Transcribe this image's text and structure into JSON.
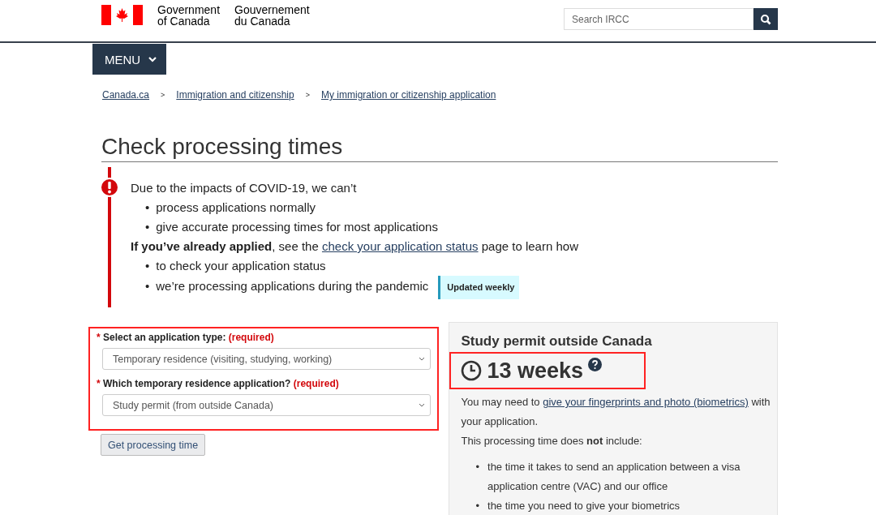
{
  "header": {
    "gov_en": [
      "Government",
      "of Canada"
    ],
    "gov_fr": [
      "Gouvernement",
      "du Canada"
    ],
    "search": {
      "placeholder": "Search IRCC"
    }
  },
  "menu": {
    "label": "MENU",
    "expanded": false
  },
  "breadcrumbs": [
    {
      "label": "Canada.ca"
    },
    {
      "label": "Immigration and citizenship",
      "separator": ">"
    },
    {
      "label": "My immigration or citizenship application",
      "separator": ">"
    }
  ],
  "title": "Check processing times",
  "alert": {
    "intro": "Due to the impacts of COVID-19, we can’t",
    "bullets_1": [
      {
        "marker": "•",
        "text": "process applications normally"
      },
      {
        "marker": "•",
        "text": "give accurate processing times for most applications"
      }
    ],
    "para": {
      "before": "**If you’ve already applied**, see the ",
      "link": "check your application status",
      "after": " page to learn how"
    },
    "bullets_2": [
      {
        "marker": "•",
        "text": "to check your application status"
      },
      {
        "marker": "•",
        "text": "we’re processing applications during the pandemic",
        "badge": "Updated weekly"
      }
    ]
  },
  "form": {
    "highlighted": true,
    "fields": [
      {
        "marker": "*",
        "label": "Select an application type:",
        "required": "(required)",
        "value": "Temporary residence (visiting, studying, working)"
      },
      {
        "marker": "*",
        "label": "Which temporary residence application?",
        "required": "(required)",
        "value": "Study permit (from outside Canada)"
      }
    ],
    "button": "Get processing time"
  },
  "result": {
    "title": "Study permit outside Canada",
    "time": "13 weeks",
    "highlighted": true,
    "intro_before": "You may need to",
    "intro_link": "give your fingerprints and photo (biometrics)",
    "intro_after": "with your application.",
    "note": "This processing time does **not** include:",
    "bullets": [
      {
        "marker": "•",
        "text": "the time it takes to send an application between a visa application centre (VAC) and our office"
      },
      {
        "marker": "•",
        "text": "the time you need to give your biometrics"
      }
    ]
  }
}
